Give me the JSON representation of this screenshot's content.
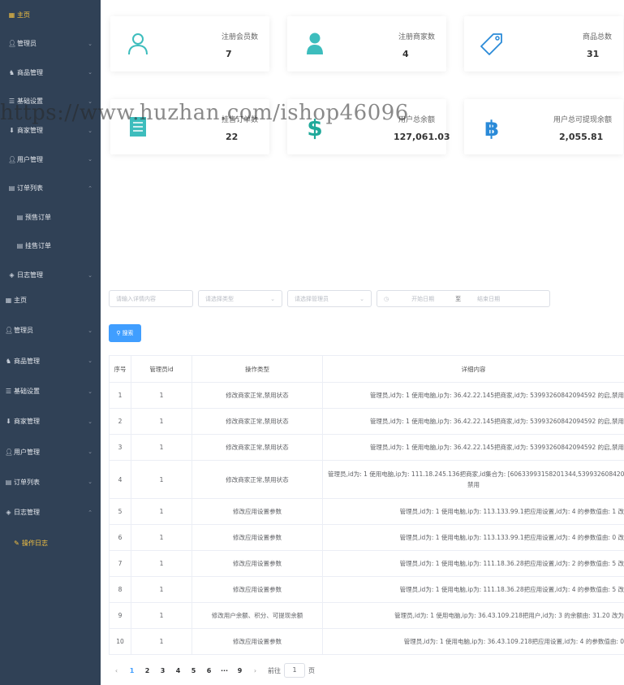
{
  "sidebar_top": {
    "items": [
      {
        "label": "主页",
        "icon": "grid-icon"
      },
      {
        "label": "管理员",
        "icon": "user-icon"
      },
      {
        "label": "商品管理",
        "icon": "bell-icon"
      },
      {
        "label": "基础设置",
        "icon": "list-icon"
      },
      {
        "label": "商家管理",
        "icon": "download-icon"
      },
      {
        "label": "用户管理",
        "icon": "user-icon"
      },
      {
        "label": "订单列表",
        "icon": "list-icon"
      },
      {
        "label": "预售订单",
        "icon": "document-icon"
      },
      {
        "label": "挂售订单",
        "icon": "document-icon"
      },
      {
        "label": "日志管理",
        "icon": "tag-icon"
      }
    ]
  },
  "sidebar_bottom": {
    "items": [
      {
        "label": "主页",
        "icon": "grid-icon"
      },
      {
        "label": "管理员",
        "icon": "user-icon"
      },
      {
        "label": "商品管理",
        "icon": "bell-icon"
      },
      {
        "label": "基础设置",
        "icon": "list-icon"
      },
      {
        "label": "商家管理",
        "icon": "download-icon"
      },
      {
        "label": "用户管理",
        "icon": "user-icon"
      },
      {
        "label": "订单列表",
        "icon": "list-icon"
      },
      {
        "label": "日志管理",
        "icon": "tag-icon"
      },
      {
        "label": "操作日志",
        "icon": "edit-icon"
      }
    ]
  },
  "stats": {
    "members_label": "注册会员数",
    "members_value": "7",
    "merchants_label": "注册商家数",
    "merchants_value": "4",
    "goods_label": "商品总数",
    "goods_value": "31",
    "orders_label": "挂售订单数",
    "orders_value": "22",
    "balance_label": "用户总余额",
    "balance_value": "127,061.03",
    "withdrawable_label": "用户总可提现余额",
    "withdrawable_value": "2,055.81"
  },
  "watermark": "https://www.huzhan.com/ishop46096",
  "filters": {
    "detail_placeholder": "请输入详情内容",
    "type_placeholder": "请选择类型",
    "admin_placeholder": "请选择管理员",
    "start_placeholder": "开始日期",
    "range_sep": "至",
    "end_placeholder": "结束日期",
    "search_label": "搜索"
  },
  "table": {
    "headers": [
      "序号",
      "管理员id",
      "操作类型",
      "详细内容"
    ],
    "rows": [
      {
        "idx": "1",
        "admin": "1",
        "type": "修改商家正常,禁用状态",
        "detail": "管理员,id为: 1 使用电脑,ip为: 36.42.22.145把商家,id为: 53993260842094592 的启,禁用"
      },
      {
        "idx": "2",
        "admin": "1",
        "type": "修改商家正常,禁用状态",
        "detail": "管理员,id为: 1 使用电脑,ip为: 36.42.22.145把商家,id为: 53993260842094592 的启,禁用"
      },
      {
        "idx": "3",
        "admin": "1",
        "type": "修改商家正常,禁用状态",
        "detail": "管理员,id为: 1 使用电脑,ip为: 36.42.22.145把商家,id为: 53993260842094592 的启,禁用"
      },
      {
        "idx": "4",
        "admin": "1",
        "type": "修改商家正常,禁用状态",
        "detail": "管理员,id为: 1 使用电脑,ip为: 111.18.245.136把商家,id集合为: [60633993158201344,53993260842094592,53",
        "detail2": "禁用"
      },
      {
        "idx": "5",
        "admin": "1",
        "type": "修改应用设置参数",
        "detail": "管理员,id为: 1 使用电脑,ip为: 113.133.99.1把应用设置,id为: 4 的参数值由: 1 改"
      },
      {
        "idx": "6",
        "admin": "1",
        "type": "修改应用设置参数",
        "detail": "管理员,id为: 1 使用电脑,ip为: 113.133.99.1把应用设置,id为: 4 的参数值由: 0 改"
      },
      {
        "idx": "7",
        "admin": "1",
        "type": "修改应用设置参数",
        "detail": "管理员,id为: 1 使用电脑,ip为: 111.18.36.28把应用设置,id为: 2 的参数值由: 5 改"
      },
      {
        "idx": "8",
        "admin": "1",
        "type": "修改应用设置参数",
        "detail": "管理员,id为: 1 使用电脑,ip为: 111.18.36.28把应用设置,id为: 4 的参数值由: 5 改"
      },
      {
        "idx": "9",
        "admin": "1",
        "type": "修改用户余额、积分、可提现余额",
        "detail": "管理员,id为: 1 使用电脑,ip为: 36.43.109.218把用户,id为: 3 的余额由: 31.20 改为"
      },
      {
        "idx": "10",
        "admin": "1",
        "type": "修改应用设置参数",
        "detail": "管理员,id为: 1 使用电脑,ip为: 36.43.109.218把应用设置,id为: 4 的参数值由: 0"
      }
    ]
  },
  "pagination": {
    "prev": "‹",
    "next": "›",
    "ellipsis": "···",
    "pages": [
      "1",
      "2",
      "3",
      "4",
      "5",
      "6",
      "9"
    ],
    "current": "1",
    "goto_label": "前往",
    "goto_value": "1",
    "page_suffix": "页"
  },
  "colors": {
    "sidebar_bg": "#304156",
    "accent_yellow": "#f5c242",
    "teal": "#3dbdbd",
    "blue": "#409eff",
    "dollar_green": "#1fa99a",
    "bitcoin_blue": "#2a8ad8"
  }
}
